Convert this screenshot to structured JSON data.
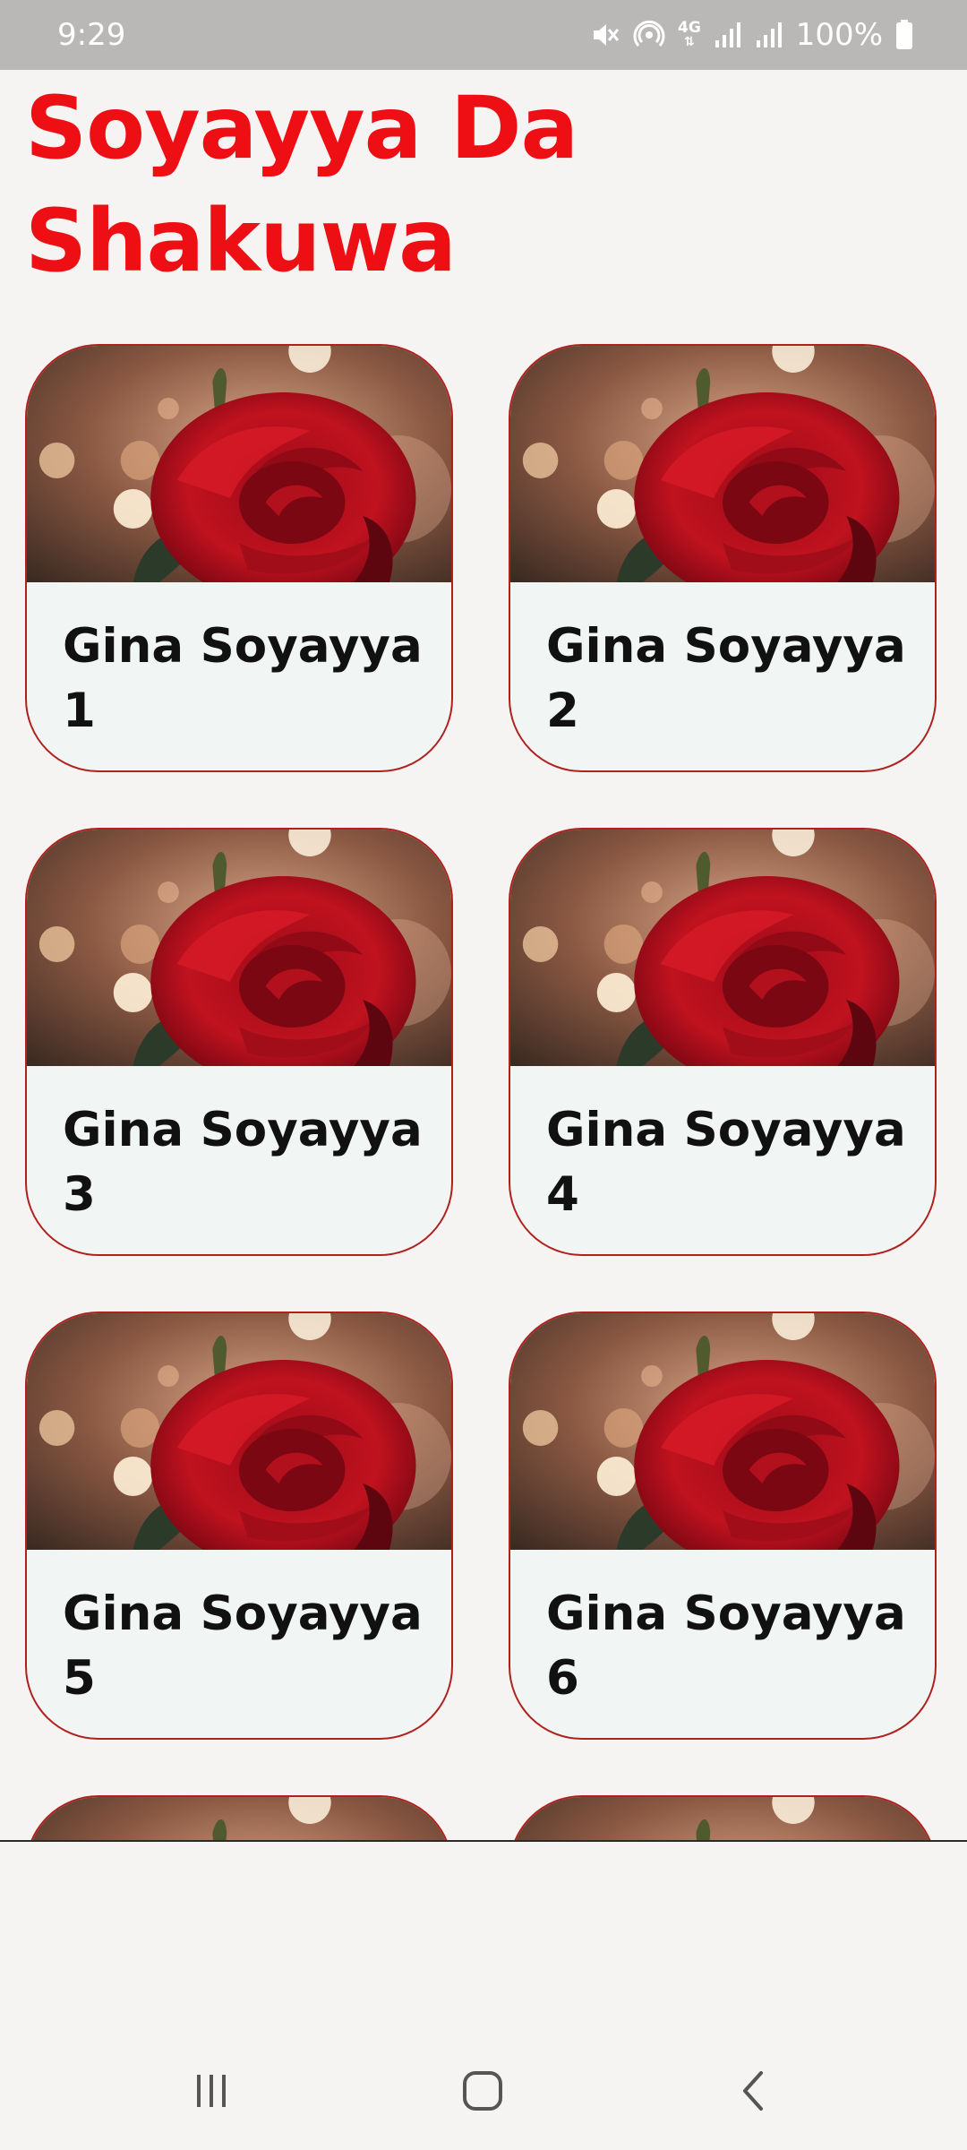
{
  "status_bar": {
    "time": "9:29",
    "network": "4G",
    "battery": "100%",
    "icons": [
      "mute-icon",
      "hotspot-icon",
      "network-4g-icon",
      "signal-icon",
      "signal-icon",
      "battery-icon"
    ]
  },
  "page": {
    "title": "Soyayya Da Shakuwa"
  },
  "cards": [
    {
      "label": "Gina Soyayya 1"
    },
    {
      "label": "Gina Soyayya 2"
    },
    {
      "label": "Gina Soyayya 3"
    },
    {
      "label": "Gina Soyayya 4"
    },
    {
      "label": "Gina Soyayya 5"
    },
    {
      "label": "Gina Soyayya 6"
    },
    {
      "label": ""
    },
    {
      "label": ""
    }
  ],
  "nav_bar": {
    "icons": [
      "recent-apps-icon",
      "home-icon",
      "back-icon"
    ]
  },
  "colors": {
    "title": "#ee0f14",
    "card_border": "#b0201c",
    "card_background": "#f1f5f4",
    "status_bar": "#b9b8b7"
  }
}
